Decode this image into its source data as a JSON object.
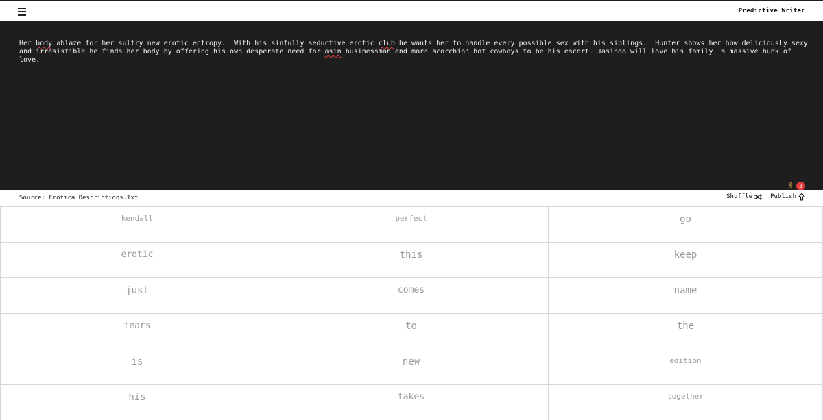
{
  "header": {
    "app_title": "Predictive Writer"
  },
  "editor": {
    "segments": [
      {
        "text": "Her ",
        "misspelled": false
      },
      {
        "text": "body",
        "misspelled": true
      },
      {
        "text": " ablaze for her sultry new erotic entropy.  With his sinfully seductive erotic ",
        "misspelled": false
      },
      {
        "text": "club",
        "misspelled": true
      },
      {
        "text": " he wants her to handle every possible sex with his siblings.  Hunter shows her how deliciously sexy and irresistible he finds her body by offering his own desperate need for ",
        "misspelled": false
      },
      {
        "text": "asin",
        "misspelled": true
      },
      {
        "text": " businessman and more scorchin' hot cowboys to be his escort. Jasinda will love his family 's massive hunk of love.",
        "misspelled": false
      }
    ],
    "reaction_icon": "victory-hand-icon",
    "reaction_count": "3",
    "accent_color": "#e33b3b"
  },
  "source_bar": {
    "source_label": "Source: Erotica Descriptions.Txt",
    "shuffle_label": "Shuffle",
    "publish_label": "Publish"
  },
  "word_grid": [
    [
      "kendall",
      "perfect",
      "go"
    ],
    [
      "erotic",
      "this",
      "keep"
    ],
    [
      "just",
      "comes",
      "name"
    ],
    [
      "tears",
      "to",
      "the"
    ],
    [
      "is",
      "new",
      "edition"
    ],
    [
      "his",
      "takes",
      "together"
    ]
  ]
}
